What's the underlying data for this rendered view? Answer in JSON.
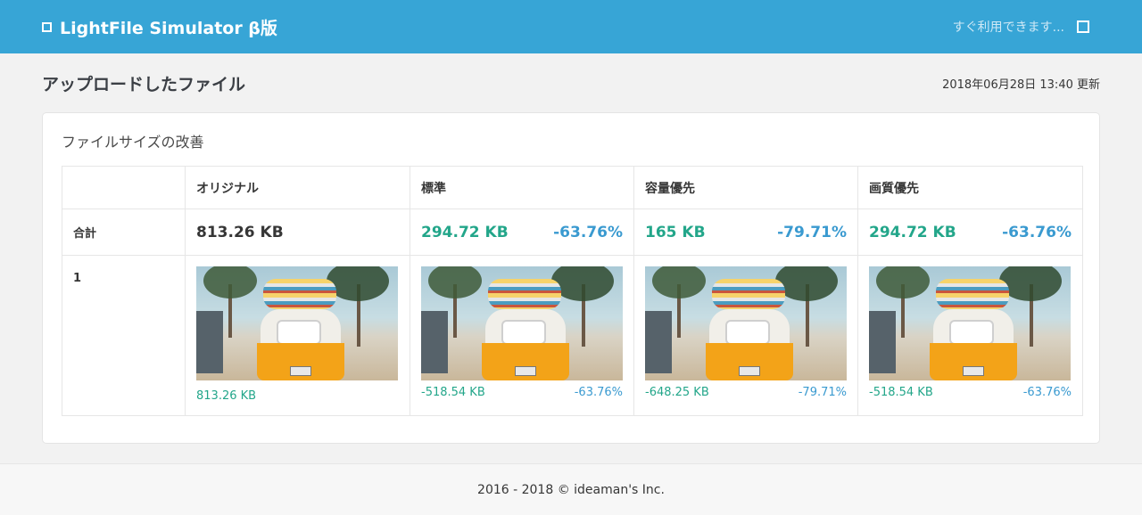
{
  "header": {
    "title": "LightFile Simulator β版",
    "status_text": "すぐ利用できます..."
  },
  "page": {
    "heading": "アップロードしたファイル",
    "updated": "2018年06月28日 13:40 更新"
  },
  "card": {
    "title": "ファイルサイズの改善",
    "columns": [
      "",
      "オリジナル",
      "標準",
      "容量優先",
      "画質優先"
    ],
    "total": {
      "label": "合計",
      "original": "813.26 KB",
      "standard": {
        "size": "294.72 KB",
        "pct": "-63.76%"
      },
      "capacity": {
        "size": "165 KB",
        "pct": "-79.71%"
      },
      "quality": {
        "size": "294.72 KB",
        "pct": "-63.76%"
      }
    },
    "files": [
      {
        "label": "1",
        "original": "813.26 KB",
        "standard": {
          "diff": "-518.54 KB",
          "pct": "-63.76%"
        },
        "capacity": {
          "diff": "-648.25 KB",
          "pct": "-79.71%"
        },
        "quality": {
          "diff": "-518.54 KB",
          "pct": "-63.76%"
        }
      }
    ]
  },
  "footer": {
    "text": "2016 - 2018 © ideaman's Inc."
  },
  "colors": {
    "topbar": "#37a5d6",
    "green": "#23a68a",
    "blue": "#3a9ad0"
  }
}
